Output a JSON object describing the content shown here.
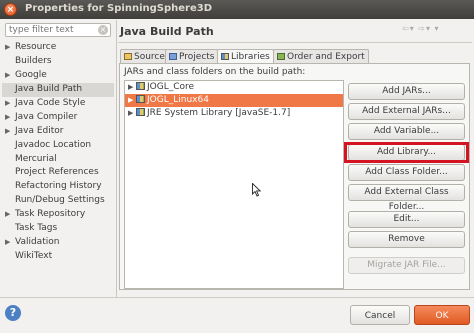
{
  "window": {
    "title": "Properties for SpinningSphere3D"
  },
  "filter": {
    "placeholder": "type filter text"
  },
  "nav": {
    "items": [
      {
        "label": "Resource",
        "expandable": true
      },
      {
        "label": "Builders",
        "expandable": false
      },
      {
        "label": "Google",
        "expandable": true
      },
      {
        "label": "Java Build Path",
        "expandable": false,
        "selected": true
      },
      {
        "label": "Java Code Style",
        "expandable": true
      },
      {
        "label": "Java Compiler",
        "expandable": true
      },
      {
        "label": "Java Editor",
        "expandable": true
      },
      {
        "label": "Javadoc Location",
        "expandable": false
      },
      {
        "label": "Mercurial",
        "expandable": false
      },
      {
        "label": "Project References",
        "expandable": false
      },
      {
        "label": "Refactoring History",
        "expandable": false
      },
      {
        "label": "Run/Debug Settings",
        "expandable": false
      },
      {
        "label": "Task Repository",
        "expandable": true
      },
      {
        "label": "Task Tags",
        "expandable": false
      },
      {
        "label": "Validation",
        "expandable": true
      },
      {
        "label": "WikiText",
        "expandable": false
      }
    ]
  },
  "page": {
    "title": "Java Build Path"
  },
  "tabs": [
    {
      "label": "Source"
    },
    {
      "label": "Projects"
    },
    {
      "label": "Libraries",
      "active": true
    },
    {
      "label": "Order and Export"
    }
  ],
  "libraries": {
    "label": "JARs and class folders on the build path:",
    "entries": [
      {
        "label": "JOGL_Core",
        "icon": "library-icon"
      },
      {
        "label": "JOGL_Linux64",
        "icon": "library-icon",
        "selected": true
      },
      {
        "label": "JRE System Library [JavaSE-1.7]",
        "icon": "library-icon"
      }
    ]
  },
  "buttons": {
    "add_jars": "Add JARs...",
    "add_external_jars": "Add External JARs...",
    "add_variable": "Add Variable...",
    "add_library": "Add Library...",
    "add_class_folder": "Add Class Folder...",
    "add_external_class_folder": "Add External Class Folder...",
    "edit": "Edit...",
    "remove": "Remove",
    "migrate_jar": "Migrate JAR File..."
  },
  "footer": {
    "cancel": "Cancel",
    "ok": "OK"
  },
  "colors": {
    "accent": "#f07746",
    "highlight_box": "#d41420",
    "ok_button": "#e05a23"
  }
}
